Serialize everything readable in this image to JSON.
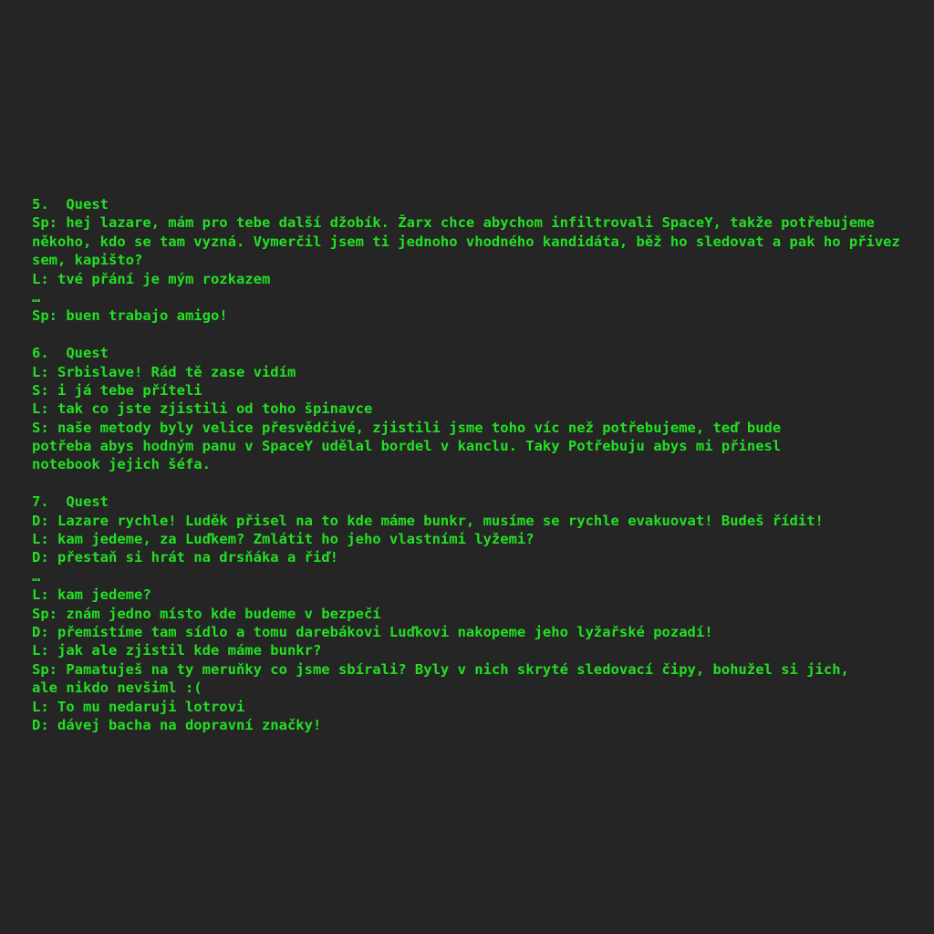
{
  "text_color": "#22e022",
  "background_color": "#252525",
  "sections": [
    {
      "lines": [
        "5.  Quest",
        "Sp: hej lazare, mám pro tebe další džobík. Žarx chce abychom infiltrovali SpaceY, takže potřebujeme",
        "někoho, kdo se tam vyzná. Vymerčil jsem ti jednoho vhodného kandidáta, běž ho sledovat a pak ho přivez",
        "sem, kapišto?",
        "L: tvé přání je mým rozkazem",
        "…",
        "Sp: buen trabajo amigo!"
      ]
    },
    {
      "lines": [
        "6.  Quest",
        "L: Srbislave! Rád tě zase vidím",
        "S: i já tebe příteli",
        "L: tak co jste zjistili od toho špinavce",
        "S: naše metody byly velice přesvědčivé, zjistili jsme toho víc než potřebujeme, teď bude",
        "potřeba abys hodným panu v SpaceY udělal bordel v kanclu. Taky Potřebuju abys mi přinesl",
        "notebook jejich šéfa."
      ]
    },
    {
      "lines": [
        "7.  Quest",
        "D: Lazare rychle! Luděk přisel na to kde máme bunkr, musíme se rychle evakuovat! Budeš řídit!",
        "L: kam jedeme, za Luďkem? Zmlátit ho jeho vlastními lyžemi?",
        "D: přestaň si hrát na drsňáka a řiď!",
        "…",
        "L: kam jedeme?",
        "Sp: znám jedno místo kde budeme v bezpečí",
        "D: přemístíme tam sídlo a tomu darebákovi Luďkovi nakopeme jeho lyžařské pozadí!",
        "L: jak ale zjistil kde máme bunkr?",
        "Sp: Pamatuješ na ty meruňky co jsme sbírali? Byly v nich skryté sledovací čipy, bohužel si jich,",
        "ale nikdo nevšiml :(",
        "L: To mu nedaruji lotrovi",
        "D: dávej bacha na dopravní značky!"
      ]
    }
  ]
}
